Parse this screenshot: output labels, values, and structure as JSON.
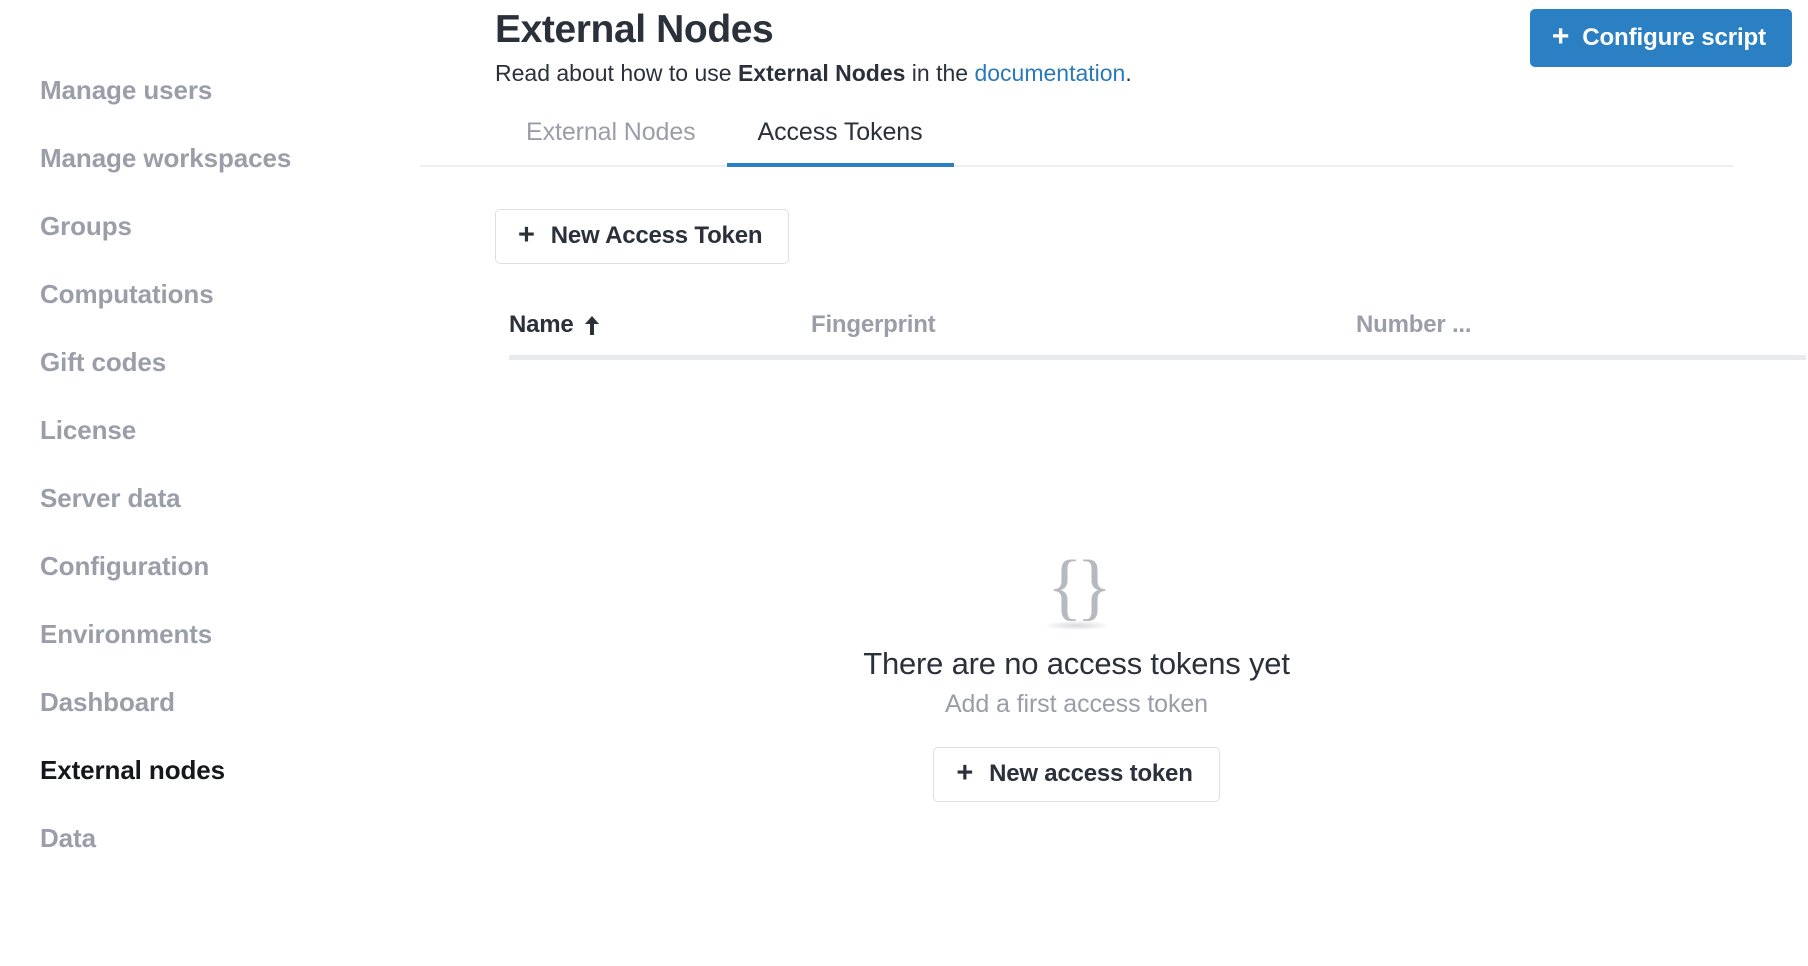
{
  "sidebar": {
    "items": [
      {
        "label": "Manage users",
        "active": false
      },
      {
        "label": "Manage workspaces",
        "active": false
      },
      {
        "label": "Groups",
        "active": false
      },
      {
        "label": "Computations",
        "active": false
      },
      {
        "label": "Gift codes",
        "active": false
      },
      {
        "label": "License",
        "active": false
      },
      {
        "label": "Server data",
        "active": false
      },
      {
        "label": "Configuration",
        "active": false
      },
      {
        "label": "Environments",
        "active": false
      },
      {
        "label": "Dashboard",
        "active": false
      },
      {
        "label": "External nodes",
        "active": true
      },
      {
        "label": "Data",
        "active": false
      }
    ]
  },
  "header": {
    "title": "External Nodes",
    "subtitle_prefix": "Read about how to use ",
    "subtitle_strong": "External Nodes",
    "subtitle_middle": " in the ",
    "subtitle_link": "documentation",
    "subtitle_suffix": ".",
    "configure_button": "Configure script",
    "plus_glyph": "+"
  },
  "tabs": [
    {
      "label": "External Nodes",
      "active": false
    },
    {
      "label": "Access Tokens",
      "active": true
    }
  ],
  "toolbar": {
    "new_token_label": "New Access Token",
    "plus_glyph": "+"
  },
  "table": {
    "columns": [
      {
        "label": "Name",
        "sorted": true,
        "sort_direction": "asc"
      },
      {
        "label": "Fingerprint",
        "sorted": false
      },
      {
        "label": "Number ...",
        "sorted": false
      }
    ],
    "rows": []
  },
  "empty_state": {
    "icon": "curly-braces-icon",
    "icon_glyph": "{}",
    "title": "There are no access tokens yet",
    "subtitle": "Add a first access token",
    "button_label": "New access token",
    "plus_glyph": "+"
  },
  "colors": {
    "accent": "#2b80c4",
    "link": "#2a7ab9",
    "text_dark": "#2b313b",
    "text_muted": "#9a9ea9",
    "divider": "#e8eaed",
    "border": "#dddfe3"
  }
}
